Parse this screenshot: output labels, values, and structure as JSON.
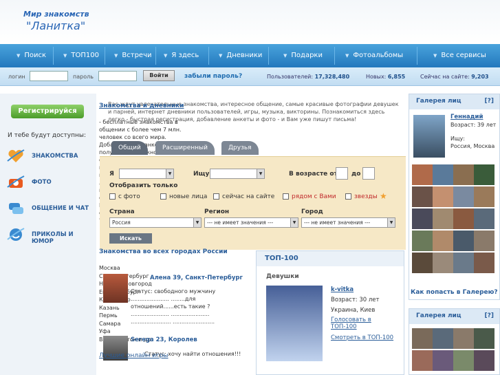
{
  "header": {
    "logo_line1": "Мир знакомств",
    "logo_line2": "\"Ланитка\""
  },
  "nav": [
    {
      "label": "Поиск"
    },
    {
      "label": "ТОП100"
    },
    {
      "label": "Встречи"
    },
    {
      "label": "Я здесь"
    },
    {
      "label": "Дневники"
    },
    {
      "label": "Подарки"
    },
    {
      "label": "Фотоальбомы"
    },
    {
      "label": "Все сервисы"
    }
  ],
  "login": {
    "login_label": "логин",
    "password_label": "пароль",
    "button": "Войти",
    "forgot": "забыли пароль?",
    "users_label": "Пользователей:",
    "users_value": "17,328,480",
    "new_label": "Новых:",
    "new_value": "6,855",
    "online_label": "Сейчас на сайте:",
    "online_value": "9,203"
  },
  "left": {
    "register": "Регистрируйся",
    "available": "И тебе будут доступны:",
    "features": [
      {
        "label": "ЗНАКОМСТВА",
        "icon": "heart-icon",
        "color": "#f0a030"
      },
      {
        "label": "ФОТО",
        "icon": "camera-icon",
        "color": "#e85a20"
      },
      {
        "label": "ОБЩЕНИЕ И ЧАТ",
        "icon": "chat-icon",
        "color": "#3a8ad0"
      },
      {
        "label": "ПРИКОЛЫ И ЮМОР",
        "icon": "smile-icon",
        "color": "#3a8ad0"
      }
    ]
  },
  "center": {
    "section1_title": "Знакомства и дневники",
    "intro": "Вас ждут увлекательные знакомства, интересное общение, самые красивые фотографии девушек и парней, интернет дневники пользователей, игры, музыка, викторины. Познакомиться здесь легко - быстрая регистрация, добавление анкеты и фото - и Вам уже пишут письма!",
    "left_text": "- бесплатные знакомства в общении с более чем 7 млн. человек со всего мира. Добавьте свою анкету и получите возможность общения с неограниченным кругом новых друзей и подруг, просматривайте и голосуйте за лучшие фото девушек и парней, заведите дневник, создавайте фотоальбомы - для Вас открыты все возможности сервиса знакомств и общения \"Ланитка\"! (www.lanitka.com)",
    "tabs": [
      "Общий",
      "Расширенный",
      "Друзья"
    ],
    "search": {
      "i_label": "Я",
      "seek_label": "Ищу",
      "age_label": "В возрасте от",
      "age_to": "до",
      "show_only": "Отобразить только",
      "photo": "с фото",
      "new_faces": "новые лица",
      "online_now": "сейчас на сайте",
      "near_you": "рядом с Вами",
      "stars": "звезды",
      "country_label": "Страна",
      "region_label": "Регион",
      "city_label": "Город",
      "country_value": "Россия",
      "region_value": "--- не имеет значения ---",
      "city_value": "--- не имеет значения ---",
      "button": "Искать"
    },
    "cities_title": "Знакомства во всех городах России",
    "cities": [
      "Москва",
      "Санкт-Петербург",
      "Нижний Новгород",
      "Екатеринбург",
      "Краснодар",
      "Казань",
      "Пермь",
      "Самара",
      "Уфа",
      "Владивосток и др."
    ],
    "users": [
      {
        "name": "Алена",
        "age": "39",
        "city": "Санкт-Петербург",
        "status": "Статус: свободного мужчину ...................... ........для отношений......есть такие ? ...................... ...................... ....................... ........................"
      },
      {
        "name": "Serega",
        "age": "23",
        "city": "Королев",
        "status": "Статус: хочу найти отношения!!!"
      }
    ],
    "games": "Лучшие онлайн игры"
  },
  "top100": {
    "title": "ТОП-100",
    "girls": "Девушки",
    "name": "k-vitka",
    "age": "Возраст: 30 лет",
    "location": "Украина, Киев",
    "vote": "Голосовать в ТОП-100",
    "view": "Смотреть в ТОП-100"
  },
  "right": {
    "gallery_title": "Галерея лиц",
    "q": "[?]",
    "person_name": "Геннадий",
    "person_age": "Возраст: 39 лет",
    "person_seek": "Ищу:",
    "person_loc": "Россия, Москва",
    "how_to": "Как попасть в Галерею?",
    "gallery2_title": "Галерея лиц"
  }
}
